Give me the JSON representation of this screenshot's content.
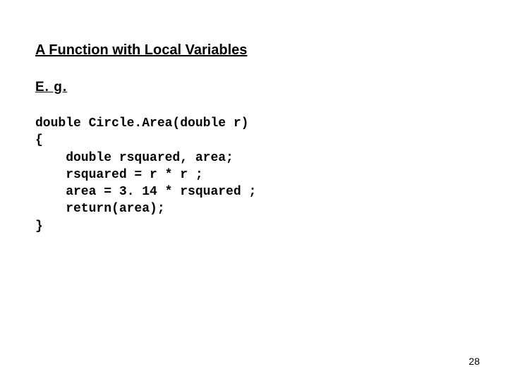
{
  "title": "A Function with Local Variables",
  "subtitle": "E. g.",
  "code": "double Circle.Area(double r)\n{\n    double rsquared, area;\n    rsquared = r * r ;\n    area = 3. 14 * rsquared ;\n    return(area);\n}",
  "page_number": "28"
}
